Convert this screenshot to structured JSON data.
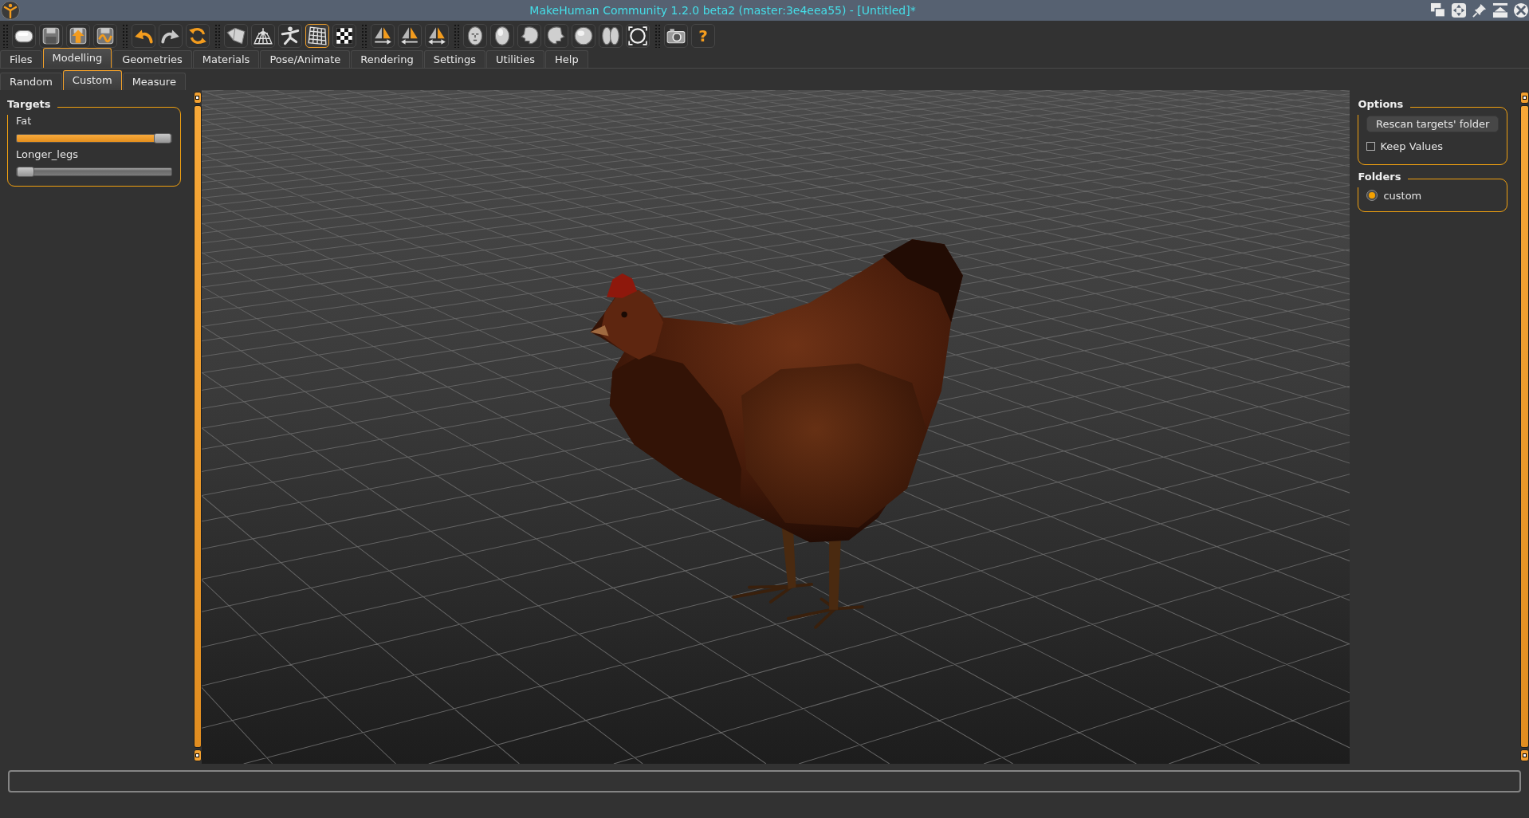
{
  "window": {
    "title": "MakeHuman Community 1.2.0 beta2 (master:3e4eea55) - [Untitled]*"
  },
  "toolbar": [
    {
      "buttons": [
        {
          "kind": "tile",
          "selected": false
        },
        {
          "kind": "floppy",
          "selected": false
        },
        {
          "kind": "upload",
          "selected": false
        },
        {
          "kind": "wave",
          "selected": false
        }
      ]
    },
    {
      "buttons": [
        {
          "kind": "undo",
          "selected": false
        },
        {
          "kind": "redo",
          "selected": false
        },
        {
          "kind": "reset",
          "selected": false
        }
      ]
    },
    {
      "buttons": [
        {
          "kind": "sheet",
          "selected": false
        },
        {
          "kind": "mesh",
          "selected": false
        },
        {
          "kind": "figure",
          "selected": false
        },
        {
          "kind": "grid",
          "selected": true
        },
        {
          "kind": "checker",
          "selected": false
        }
      ]
    },
    {
      "buttons": [
        {
          "kind": "mirrorright",
          "selected": false
        },
        {
          "kind": "mirrorleft",
          "selected": false
        },
        {
          "kind": "mirrorboth",
          "selected": false
        }
      ]
    },
    {
      "buttons": [
        {
          "kind": "front",
          "selected": false
        },
        {
          "kind": "back",
          "selected": false
        },
        {
          "kind": "left",
          "selected": false
        },
        {
          "kind": "right",
          "selected": false
        },
        {
          "kind": "top",
          "selected": false
        },
        {
          "kind": "bottom",
          "selected": false
        },
        {
          "kind": "frame",
          "selected": false
        }
      ]
    },
    {
      "buttons": [
        {
          "kind": "camera",
          "selected": false
        },
        {
          "kind": "help",
          "label": "?",
          "selected": false
        }
      ]
    }
  ],
  "tabs": [
    {
      "label": "Files",
      "selected": false
    },
    {
      "label": "Modelling",
      "selected": true
    },
    {
      "label": "Geometries",
      "selected": false
    },
    {
      "label": "Materials",
      "selected": false
    },
    {
      "label": "Pose/Animate",
      "selected": false
    },
    {
      "label": "Rendering",
      "selected": false
    },
    {
      "label": "Settings",
      "selected": false
    },
    {
      "label": "Utilities",
      "selected": false
    },
    {
      "label": "Help",
      "selected": false
    }
  ],
  "subtabs": [
    {
      "label": "Random",
      "selected": false
    },
    {
      "label": "Custom",
      "selected": true
    },
    {
      "label": "Measure",
      "selected": false
    }
  ],
  "targets": {
    "title": "Targets",
    "sliders": [
      {
        "label": "Fat",
        "level": 1
      },
      {
        "label": "Longer_legs",
        "level": 0
      }
    ]
  },
  "options": {
    "title": "Options",
    "button": "Rescan targets' folder",
    "checkbox": {
      "label": "Keep Values",
      "checked": false
    }
  },
  "folders": {
    "title": "Folders",
    "items": [
      {
        "label": "custom",
        "selected": true
      }
    ]
  }
}
